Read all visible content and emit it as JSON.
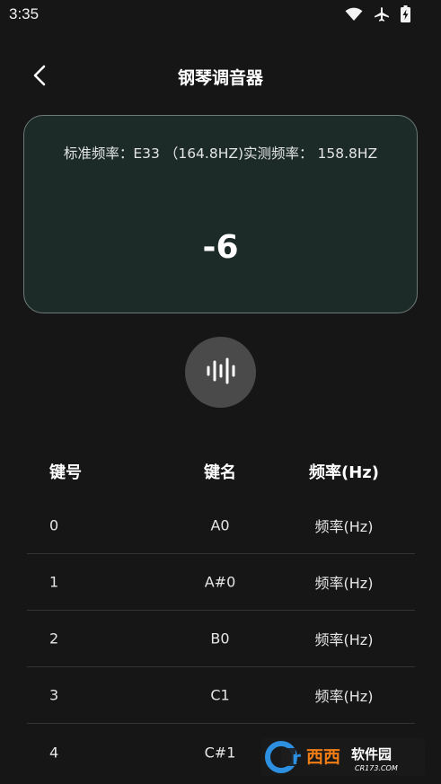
{
  "status_bar": {
    "time": "3:35"
  },
  "header": {
    "title": "钢琴调音器"
  },
  "tuner": {
    "standard_label": "标准频率：",
    "standard_note": "E33",
    "standard_freq": "（164.8HZ)",
    "measured_label": "实测频率：",
    "measured_freq": "158.8HZ",
    "deviation": "-6"
  },
  "table": {
    "headers": {
      "number": "键号",
      "name": "键名",
      "frequency": "频率(Hz)"
    },
    "rows": [
      {
        "number": "0",
        "name": "A0",
        "frequency": "频率(Hz)"
      },
      {
        "number": "1",
        "name": "A#0",
        "frequency": "频率(Hz)"
      },
      {
        "number": "2",
        "name": "B0",
        "frequency": "频率(Hz)"
      },
      {
        "number": "3",
        "name": "C1",
        "frequency": "频率(Hz)"
      },
      {
        "number": "4",
        "name": "C#1",
        "frequency": ""
      }
    ]
  },
  "watermark": {
    "text": "西西软件园",
    "subtext": "CR173.COM"
  },
  "colors": {
    "background": "#161616",
    "card": "#1c2a28",
    "card_border": "#6e7a78",
    "mic_button": "#4a4a4a"
  },
  "icons": {
    "back": "back-arrow-icon",
    "mic": "sound-wave-icon",
    "wifi": "wifi-icon",
    "airplane": "airplane-icon",
    "battery": "battery-charging-icon"
  }
}
